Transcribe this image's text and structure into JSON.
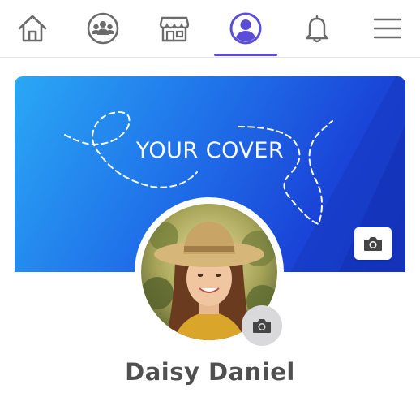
{
  "nav": {
    "items": [
      {
        "icon": "home-icon",
        "active": false
      },
      {
        "icon": "groups-icon",
        "active": false
      },
      {
        "icon": "store-icon",
        "active": false
      },
      {
        "icon": "profile-icon",
        "active": true
      },
      {
        "icon": "bell-icon",
        "active": false
      },
      {
        "icon": "menu-icon",
        "active": false
      }
    ],
    "active_color": "#5b4dd6",
    "inactive_color": "#6b6b6b"
  },
  "cover": {
    "title": "YOUR COVER",
    "gradient_start": "#2aa8f5",
    "gradient_end": "#1637c7",
    "camera_icon": "camera-icon"
  },
  "profile": {
    "name": "Daisy Daniel",
    "avatar_camera_icon": "camera-icon"
  }
}
